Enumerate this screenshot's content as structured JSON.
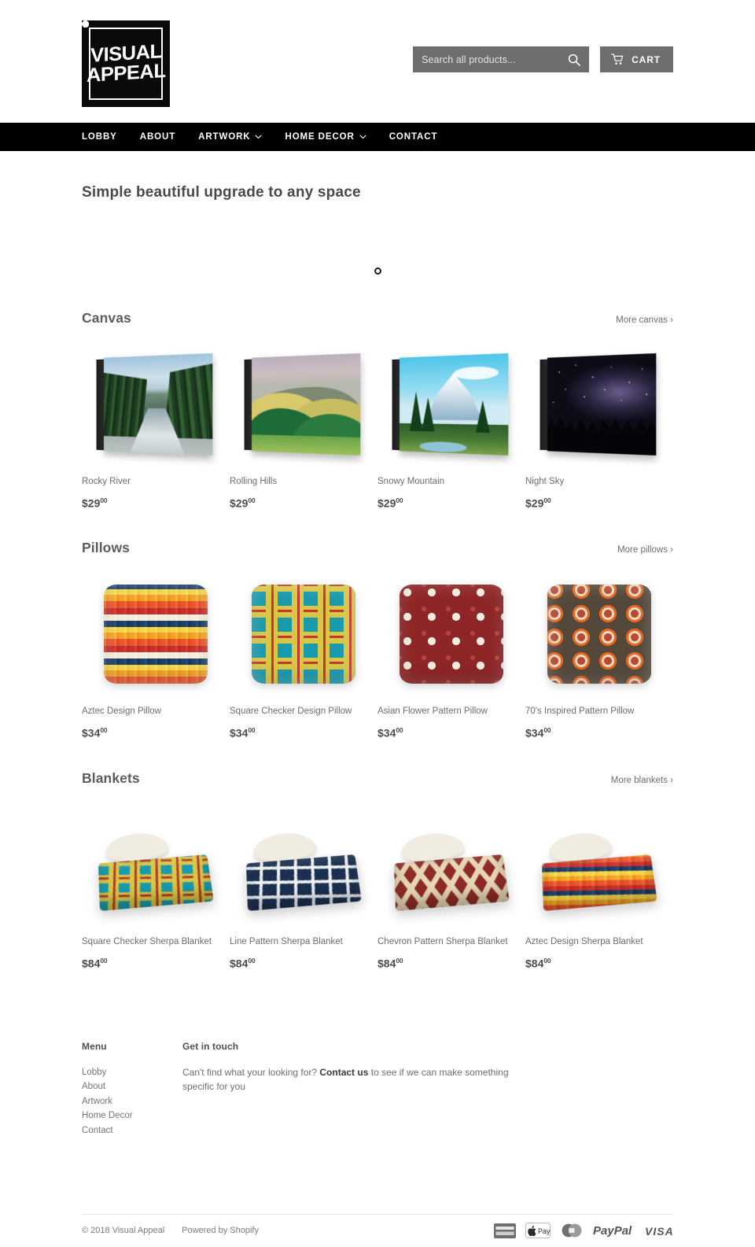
{
  "header": {
    "logo": {
      "line1": "VISUAL",
      "line2": "APPEAL",
      "icon": "stamp-logo"
    },
    "search": {
      "placeholder": "Search all products...",
      "value": "",
      "icon": "search-icon"
    },
    "cart": {
      "label": "CART",
      "icon": "shopping-cart-icon"
    }
  },
  "nav": {
    "items": [
      {
        "label": "LOBBY",
        "has_dropdown": false
      },
      {
        "label": "ABOUT",
        "has_dropdown": false
      },
      {
        "label": "ARTWORK",
        "has_dropdown": true
      },
      {
        "label": "HOME DECOR",
        "has_dropdown": true
      },
      {
        "label": "CONTACT",
        "has_dropdown": false
      }
    ]
  },
  "hero": {
    "title": "Simple beautiful upgrade to any space"
  },
  "sections": [
    {
      "title": "Canvas",
      "more_label": "More canvas ›",
      "products": [
        {
          "title": "Rocky River",
          "price_dollars": "$29",
          "price_cents": "00",
          "art": "art-river"
        },
        {
          "title": "Rolling Hills",
          "price_dollars": "$29",
          "price_cents": "00",
          "art": "art-hills"
        },
        {
          "title": "Snowy Mountain",
          "price_dollars": "$29",
          "price_cents": "00",
          "art": "art-mtn"
        },
        {
          "title": "Night Sky",
          "price_dollars": "$29",
          "price_cents": "00",
          "art": "art-night"
        }
      ]
    },
    {
      "title": "Pillows",
      "more_label": "More pillows ›",
      "products": [
        {
          "title": "Aztec Design Pillow",
          "price_dollars": "$34",
          "price_cents": "00",
          "art": "p-aztec"
        },
        {
          "title": "Square Checker Design Pillow",
          "price_dollars": "$34",
          "price_cents": "00",
          "art": "p-checker"
        },
        {
          "title": "Asian Flower Pattern Pillow",
          "price_dollars": "$34",
          "price_cents": "00",
          "art": "p-flower"
        },
        {
          "title": "70's Inspired Pattern Pillow",
          "price_dollars": "$34",
          "price_cents": "00",
          "art": "p-hex"
        }
      ]
    },
    {
      "title": "Blankets",
      "more_label": "More blankets ›",
      "products": [
        {
          "title": "Square Checker Sherpa Blanket",
          "price_dollars": "$84",
          "price_cents": "00",
          "art": "b-checker"
        },
        {
          "title": "Line Pattern Sherpa Blanket",
          "price_dollars": "$84",
          "price_cents": "00",
          "art": "b-line"
        },
        {
          "title": "Chevron Pattern Sherpa Blanket",
          "price_dollars": "$84",
          "price_cents": "00",
          "art": "b-chevron"
        },
        {
          "title": "Aztec Design Sherpa Blanket",
          "price_dollars": "$84",
          "price_cents": "00",
          "art": "b-aztec"
        }
      ]
    }
  ],
  "footer": {
    "menu_heading": "Menu",
    "menu_links": [
      "Lobby",
      "About",
      "Artwork",
      "Home Decor",
      "Contact"
    ],
    "touch_heading": "Get in touch",
    "touch_text_before": "Can't find what your looking for? ",
    "touch_link": "Contact us",
    "touch_text_after": " to see if we can make something specific for you",
    "copyright": "© 2018 Visual Appeal",
    "powered_by": "Powered by Shopify",
    "payment_icons": [
      "american-express",
      "apple-pay",
      "mastercard",
      "paypal",
      "visa"
    ]
  },
  "colors": {
    "nav_bg": "#000000",
    "control_gray": "#6e6e6e",
    "text_gray": "#6d6d6d"
  }
}
